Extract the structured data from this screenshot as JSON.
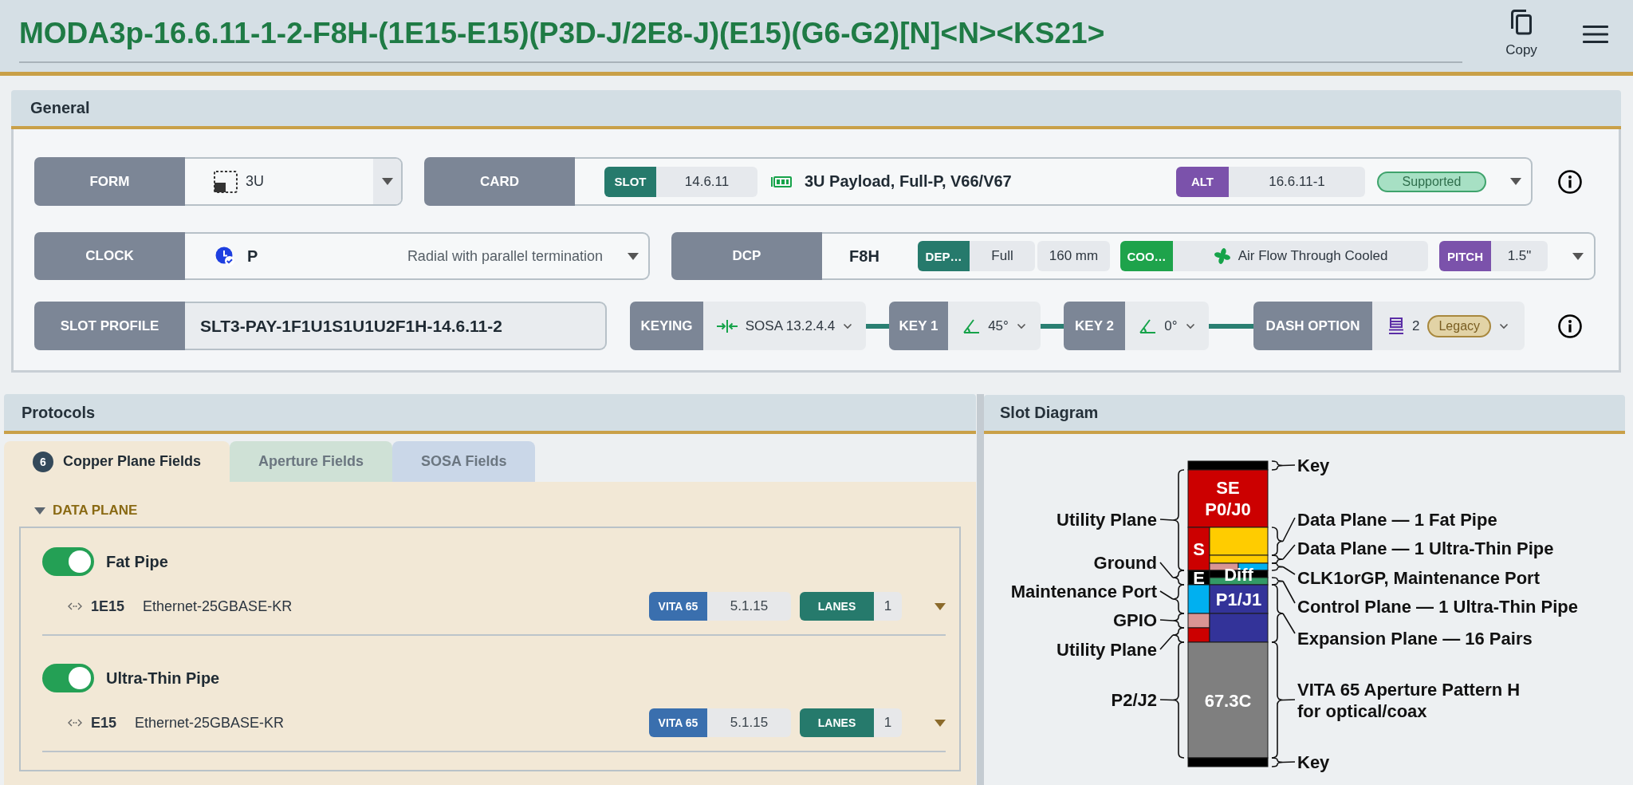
{
  "header": {
    "title": "MODA3p-16.6.11-1-2-F8H-(1E15-E15)(P3D-J/2E8-J)(E15)(G6-G2)[N]<N><KS21>",
    "copy_label": "Copy"
  },
  "general": {
    "title": "General",
    "form": {
      "label": "FORM",
      "value": "3U"
    },
    "card": {
      "label": "CARD",
      "slot": {
        "label": "SLOT",
        "value": "14.6.11",
        "color": "#267a6c"
      },
      "name": "3U Payload, Full-P, V66/V67",
      "alt": {
        "label": "ALT",
        "value": "16.6.11-1",
        "color": "#7b52ab"
      },
      "status": "Supported"
    },
    "clock": {
      "label": "CLOCK",
      "value": "P",
      "description": "Radial with parallel termination"
    },
    "dcp": {
      "label": "DCP",
      "value": "F8H",
      "depth": {
        "label": "DEP…",
        "value": "Full",
        "size": "160 mm",
        "color": "#267a6c"
      },
      "cooling": {
        "label": "COO…",
        "value": "Air Flow Through Cooled",
        "color": "#1ea34b"
      },
      "pitch": {
        "label": "PITCH",
        "value": "1.5\"",
        "color": "#7b52ab"
      }
    },
    "slot_profile": {
      "label": "SLOT PROFILE",
      "value": "SLT3-PAY-1F1U1S1U1U2F1H-14.6.11-2"
    },
    "keying": [
      {
        "kind": "keying",
        "label": "KEYING",
        "value": "SOSA 13.2.4.4"
      },
      {
        "kind": "angle",
        "label": "KEY 1",
        "value": "45°"
      },
      {
        "kind": "angle",
        "label": "KEY 2",
        "value": "0°"
      },
      {
        "kind": "dash",
        "label": "DASH OPTION",
        "value": "2",
        "tag": "Legacy"
      }
    ]
  },
  "protocols": {
    "title": "Protocols",
    "tabs": [
      {
        "label": "Copper Plane Fields",
        "count": "6",
        "selected": true,
        "color": "#f2e8d6"
      },
      {
        "label": "Aperture Fields",
        "selected": false,
        "color": "#cfe1d6"
      },
      {
        "label": "SOSA Fields",
        "selected": false,
        "color": "#cad7e8"
      }
    ],
    "group": {
      "title": "DATA PLANE",
      "expanded": true,
      "fields": [
        {
          "name": "Fat Pipe",
          "on": true,
          "code": "1E15",
          "protocol": "Ethernet-25GBASE-KR",
          "standard": {
            "label": "VITA 65",
            "value": "5.1.15",
            "color": "#3a6fae"
          },
          "lanes": {
            "label": "LANES",
            "value": "1",
            "color": "#267a6c"
          }
        },
        {
          "name": "Ultra-Thin Pipe",
          "on": true,
          "code": "E15",
          "protocol": "Ethernet-25GBASE-KR",
          "standard": {
            "label": "VITA 65",
            "value": "5.1.15",
            "color": "#3a6fae"
          },
          "lanes": {
            "label": "LANES",
            "value": "1",
            "color": "#267a6c"
          }
        }
      ]
    }
  },
  "slot_diagram": {
    "title": "Slot Diagram",
    "blocks": [
      {
        "color": "#000000"
      },
      {
        "color": "#cc0000",
        "lines": [
          "SE",
          "P0/J0"
        ]
      },
      {
        "color": "#cc0000",
        "lines": [
          "S"
        ]
      },
      {
        "color": "#000000",
        "lines": [
          "E"
        ]
      },
      {
        "color": "#00b0f0"
      },
      {
        "color": "#d99594"
      },
      {
        "color": "#cc0000"
      },
      {
        "color": "#ffcc00"
      },
      {
        "color": "#ffcc00"
      },
      {
        "color": "#d99594"
      },
      {
        "color": "#00b0f0"
      },
      {
        "color": "#000000",
        "lines": [
          "Diff"
        ]
      },
      {
        "color": "#339966"
      },
      {
        "color": "#333399",
        "lines": [
          "P1/J1"
        ]
      },
      {
        "color": "#333399"
      },
      {
        "color": "#7f7f7f",
        "lines": [
          "67.3C"
        ]
      },
      {
        "color": "#000000"
      }
    ],
    "left_labels": [
      {
        "lines": [
          "Utility Plane"
        ]
      },
      {
        "lines": [
          "Ground"
        ]
      },
      {
        "lines": [
          "Maintenance Port"
        ]
      },
      {
        "lines": [
          "GPIO"
        ]
      },
      {
        "lines": [
          "Utility Plane"
        ]
      },
      {
        "lines": [
          "P2/J2"
        ]
      }
    ],
    "right_labels": [
      {
        "lines": [
          "Key"
        ]
      },
      {
        "lines": [
          "Data Plane — 1 Fat Pipe"
        ]
      },
      {
        "lines": [
          "Data Plane — 1 Ultra-Thin Pipe"
        ]
      },
      {
        "lines": [
          "CLK1orGP, Maintenance Port"
        ]
      },
      {
        "lines": [
          "Control Plane — 1 Ultra-Thin Pipe"
        ]
      },
      {
        "lines": [
          "Expansion Plane — 16 Pairs"
        ]
      },
      {
        "lines": [
          "VITA 65 Aperture Pattern H",
          "for optical/coax"
        ]
      },
      {
        "lines": [
          "Key"
        ]
      }
    ]
  }
}
